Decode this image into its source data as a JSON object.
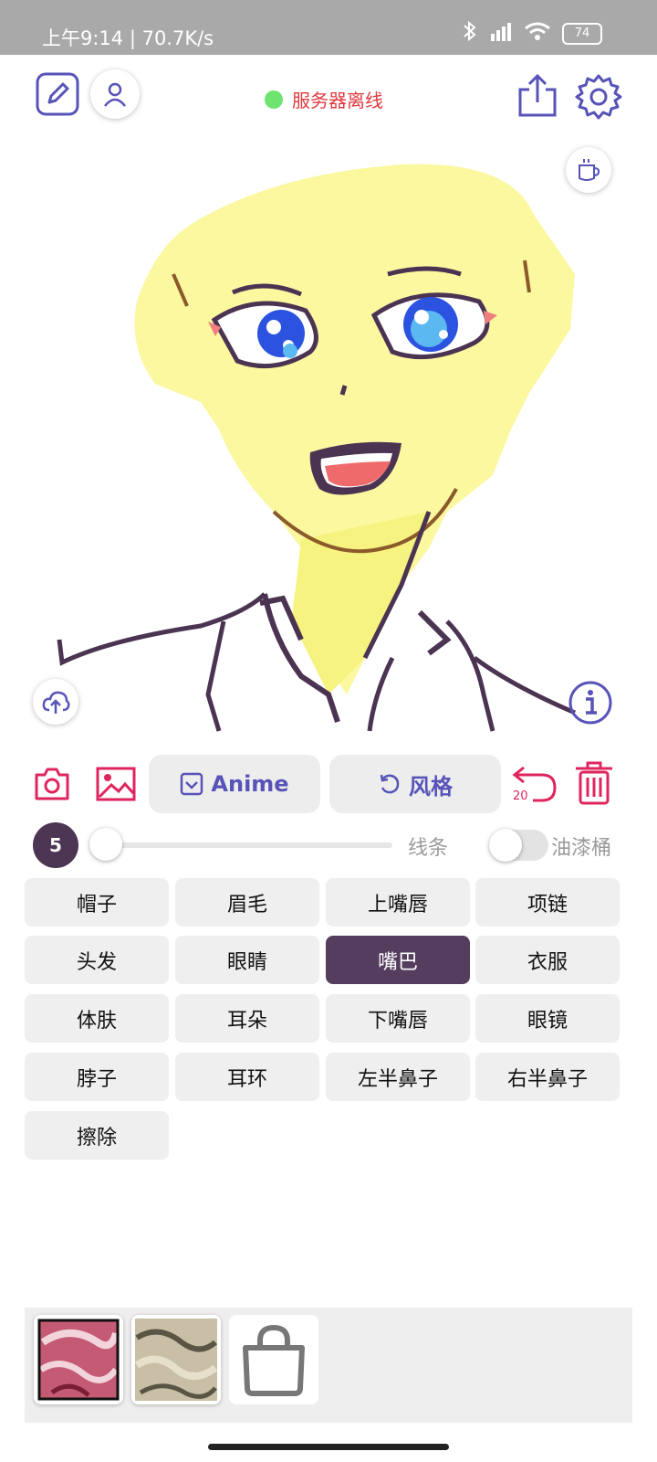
{
  "statusbar": {
    "time_and_speed": "上午9:14 | 70.7K/s",
    "battery": "74"
  },
  "header": {
    "server_status": "服务器离线",
    "status_color": "#6fe36f"
  },
  "toolbar": {
    "model_label": "Anime",
    "style_label": "风格",
    "undo_count": "20"
  },
  "controls": {
    "brush_size": "5",
    "line_label": "线条",
    "bucket_label": "油漆桶"
  },
  "categories": [
    {
      "label": "帽子"
    },
    {
      "label": "眉毛"
    },
    {
      "label": "上嘴唇"
    },
    {
      "label": "项链"
    },
    {
      "label": "头发"
    },
    {
      "label": "眼睛"
    },
    {
      "label": "嘴巴"
    },
    {
      "label": "衣服"
    },
    {
      "label": "体肤"
    },
    {
      "label": "耳朵"
    },
    {
      "label": "下嘴唇"
    },
    {
      "label": "眼镜"
    },
    {
      "label": "脖子"
    },
    {
      "label": "耳环"
    },
    {
      "label": "左半鼻子"
    },
    {
      "label": "右半鼻子"
    },
    {
      "label": "擦除"
    }
  ],
  "selected_category": "嘴巴",
  "colors": {
    "accent": "#5753b8",
    "action_red": "#e0245e",
    "selected": "#553d5e",
    "skin": "#fbf8a0"
  }
}
